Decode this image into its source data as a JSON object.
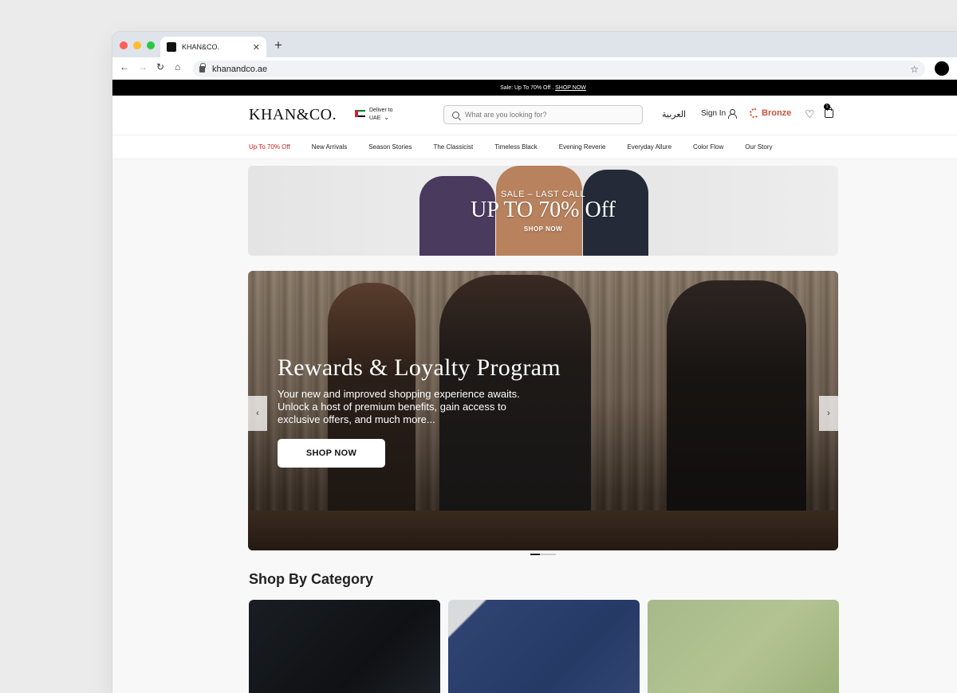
{
  "browser": {
    "tab_title": "KHAN&CO.",
    "tab_close": "✕",
    "new_tab": "+",
    "url": "khanandco.ae"
  },
  "announcement": {
    "text": "Sale: Up To 70% Off .",
    "link": "SHOP NOW"
  },
  "header": {
    "logo": "KHAN&CO.",
    "deliver_label": "Deliver to",
    "deliver_country": "UAE",
    "search_placeholder": "What are you looking for?",
    "language": "العربية",
    "sign_in": "Sign In",
    "loyalty_tier": "Bronze",
    "cart_count": "1"
  },
  "nav": {
    "items": [
      "Up To 70% Off",
      "New Arrivals",
      "Season Stories",
      "The Classicist",
      "Timeless Black",
      "Evening Reverie",
      "Everyday Allure",
      "Color Flow",
      "Our Story"
    ]
  },
  "promo": {
    "subtitle": "SALE – LAST CALL",
    "headline": "UP TO 70% Off",
    "cta": "SHOP NOW"
  },
  "hero": {
    "title": "Rewards & Loyalty Program",
    "text": "Your new and improved shopping experience awaits. Unlock a host of premium benefits, gain access to exclusive offers, and much more...",
    "cta": "SHOP NOW",
    "slide_index": 1,
    "slide_count": 2
  },
  "categories": {
    "title": "Shop By Category"
  },
  "colors": {
    "accent_sale": "#d11a1a",
    "loyalty_bronze": "#c9533a",
    "announce_bg": "#000000"
  }
}
